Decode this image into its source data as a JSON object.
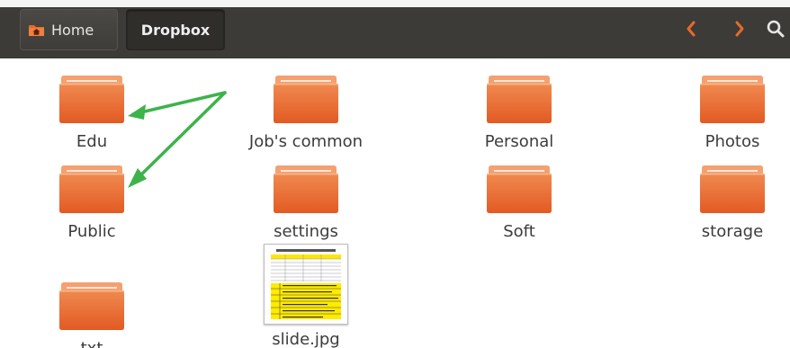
{
  "breadcrumb": {
    "home_label": "Home",
    "current_label": "Dropbox"
  },
  "navigation": {
    "back_icon": "chevron-left-icon",
    "forward_icon": "chevron-right-icon",
    "search_icon": "search-icon"
  },
  "colors": {
    "header_bg": "#3c3b37",
    "accent_orange": "#e8692a",
    "folder_top": "#f5a070",
    "folder_body": "#e25a23",
    "arrow_green": "#3db34a",
    "label_text": "#3c3c3c"
  },
  "items": [
    {
      "name": "Edu",
      "type": "folder"
    },
    {
      "name": "Job's common",
      "type": "folder"
    },
    {
      "name": "Personal",
      "type": "folder"
    },
    {
      "name": "Photos",
      "type": "folder"
    },
    {
      "name": "Public",
      "type": "folder"
    },
    {
      "name": "settings",
      "type": "folder"
    },
    {
      "name": "Soft",
      "type": "folder"
    },
    {
      "name": "storage",
      "type": "folder"
    },
    {
      "name": "txt",
      "type": "folder"
    },
    {
      "name": "slide.jpg",
      "type": "image"
    }
  ]
}
